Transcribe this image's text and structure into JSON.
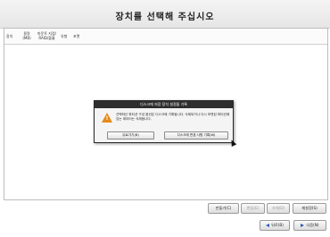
{
  "header": {
    "title": "장치를 선택해 주십시오"
  },
  "table": {
    "columns": {
      "device": "장치",
      "size_line1": "용량",
      "size_line2": "(MB)",
      "mount_line1": "마운트 지점/",
      "mount_line2": "RAID/볼륨",
      "type": "유형",
      "format": "포맷"
    }
  },
  "dialog": {
    "title": "디스크에 저장 장치 설정을 기록",
    "message": "선택하신 파티션 구성 옵션은 디스크에 기록됩니다. 삭제되거나 다시 포맷된 파티션에 있는 데이터는 삭제됩니다.",
    "back_label": "뒤로가기(B)",
    "write_label": "디스크에 변경 사항 기록(W)",
    "icon": "warning-icon"
  },
  "actions": {
    "create": "만들기(C)",
    "edit": "편집(E)",
    "delete": "삭제(D)",
    "reset": "재설정(S)"
  },
  "nav": {
    "back": "뒤로(B)",
    "next": "다음(N)"
  },
  "colors": {
    "warning": "#e48a1a",
    "dialog_title_bg": "#2e2e2e",
    "arrow": "#2a5db0"
  }
}
